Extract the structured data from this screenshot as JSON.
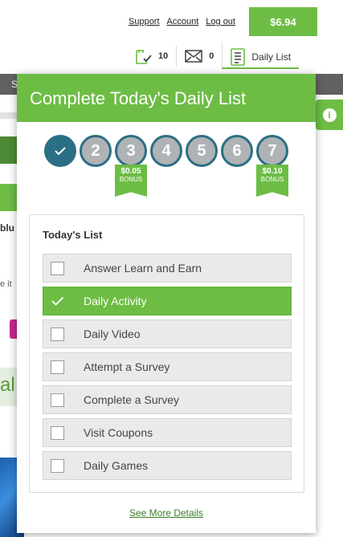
{
  "header": {
    "links": [
      "Support",
      "Account",
      "Log out"
    ],
    "balance": "$6.94"
  },
  "status": {
    "polls_count": "10",
    "messages_count": "0",
    "daily_list_label": "Daily List"
  },
  "background": {
    "nav_fragment": "S",
    "text_fragment_1": "blu",
    "text_fragment_2": "e it",
    "band_fragment": "al"
  },
  "daily_list": {
    "title": "Complete Today's Daily List",
    "steps": [
      {
        "label": "",
        "state": "done"
      },
      {
        "label": "2",
        "state": "pending"
      },
      {
        "label": "3",
        "state": "pending",
        "bonus_amount": "$0.05",
        "bonus_label": "BONUS"
      },
      {
        "label": "4",
        "state": "pending"
      },
      {
        "label": "5",
        "state": "pending"
      },
      {
        "label": "6",
        "state": "pending"
      },
      {
        "label": "7",
        "state": "pending",
        "bonus_amount": "$0.10",
        "bonus_label": "BONUS"
      }
    ],
    "list_heading": "Today's List",
    "items": [
      {
        "label": "Answer Learn and Earn",
        "checked": false
      },
      {
        "label": "Daily Activity",
        "checked": true
      },
      {
        "label": "Daily Video",
        "checked": false
      },
      {
        "label": "Attempt a Survey",
        "checked": false
      },
      {
        "label": "Complete a Survey",
        "checked": false
      },
      {
        "label": "Visit Coupons",
        "checked": false
      },
      {
        "label": "Daily Games",
        "checked": false
      }
    ],
    "see_more": "See More Details"
  },
  "colors": {
    "brand_green": "#6dbd45",
    "step_teal": "#2b6f85",
    "step_gray": "#b0b3b6"
  },
  "icons": [
    "poll-check-icon",
    "envelope-icon",
    "daily-list-icon",
    "checkmark-icon",
    "info-icon"
  ]
}
